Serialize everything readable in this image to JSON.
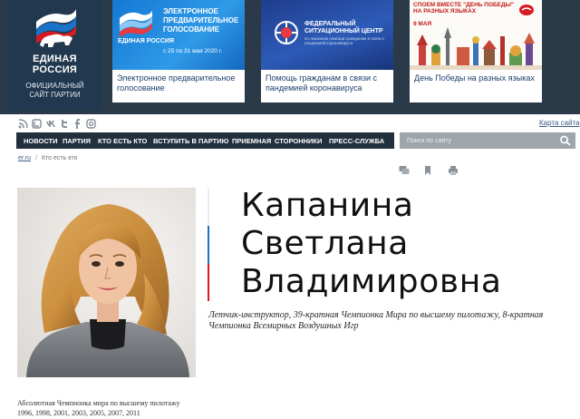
{
  "banner": {
    "logo": {
      "title_line1": "ЕДИНАЯ",
      "title_line2": "РОССИЯ",
      "subtitle_line1": "ОФИЦИАЛЬНЫЙ",
      "subtitle_line2": "САЙТ ПАРТИИ"
    },
    "promos": [
      {
        "image_title": "ЭЛЕКТРОННОЕ ПРЕДВАРИТЕЛЬНОЕ ГОЛОСОВАНИЕ",
        "image_dates": "с 25 по 31 мая 2020 г.",
        "image_brand": "ЕДИНАЯ РОССИЯ",
        "caption": "Электронное предварительное голосование"
      },
      {
        "image_title": "ФЕДЕРАЛЬНЫЙ СИТУАЦИОННЫЙ ЦЕНТР",
        "image_sub": "по оказанию помощи гражданам в связи с пандемией коронавируса",
        "caption": "Помощь гражданам в связи с пандемией коронавируса"
      },
      {
        "image_title": "СПОЕМ ВМЕСТЕ \"ДЕНЬ ПОБЕДЫ\" НА РАЗНЫХ ЯЗЫКАХ",
        "image_date": "9 МАЯ",
        "caption": "День Победы на разных языках"
      }
    ]
  },
  "social": {
    "icons": [
      "rss-icon",
      "lj-icon",
      "vk-icon",
      "twitter-icon",
      "facebook-icon",
      "instagram-icon"
    ],
    "sitemap_label": "Карта сайта"
  },
  "nav": {
    "items": [
      "НОВОСТИ",
      "ПАРТИЯ",
      "КТО ЕСТЬ КТО",
      "ВСТУПИТЬ В ПАРТИЮ",
      "ПРИЕМНАЯ",
      "СТОРОННИКИ",
      "ПРЕСС-СЛУЖБА"
    ],
    "search_placeholder": "Поиск по сайту"
  },
  "breadcrumb": {
    "home": "er.ru",
    "separator": "/",
    "current": "Кто есть кто"
  },
  "profile": {
    "name_line1": "Капанина",
    "name_line2": "Светлана",
    "name_line3": "Владимировна",
    "position": "Летчик-инструктор, 39-кратная Чемпионка Мира по высшему пилотажу, 8-кратная Чемпионка Всемирных Воздушных Игр",
    "bio_line1": "Абсолютная Чемпионка мира по высшему пилотажу",
    "bio_line2": "1996, 1998, 2001, 2003, 2005, 2007, 2011"
  },
  "colors": {
    "banner_bg": "#2b3a48",
    "nav_bg": "#22303e",
    "flag_white": "#e9ecef",
    "flag_blue": "#1a73c6",
    "flag_red": "#d71a21",
    "link": "#3a5b86"
  }
}
